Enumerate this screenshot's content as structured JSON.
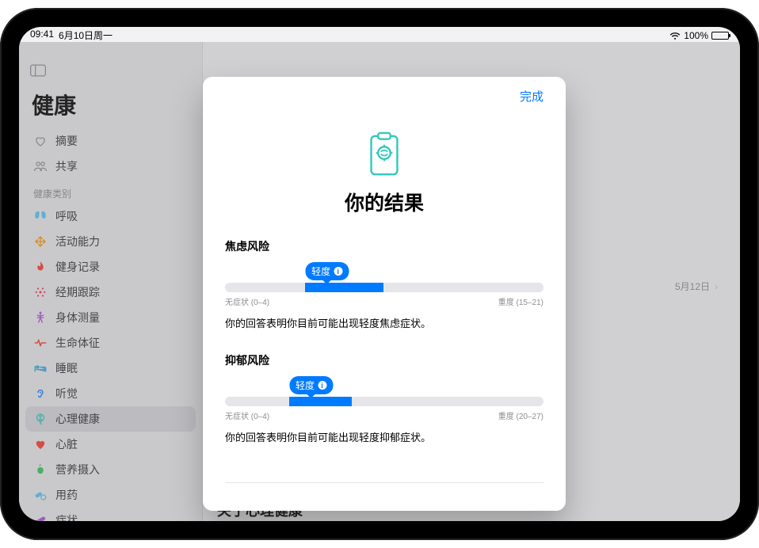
{
  "status": {
    "time": "09:41",
    "date": "6月10日周一",
    "battery_pct": "100%"
  },
  "sidebar": {
    "title": "健康",
    "summary_label": "摘要",
    "share_label": "共享",
    "category_heading": "健康类别",
    "items": [
      {
        "label": "呼吸",
        "icon": "lungs",
        "color": "#5ac8fa"
      },
      {
        "label": "活动能力",
        "icon": "arrows",
        "color": "#ff9500"
      },
      {
        "label": "健身记录",
        "icon": "flame",
        "color": "#ff3b30"
      },
      {
        "label": "经期跟踪",
        "icon": "dots-circle",
        "color": "#ff2d55"
      },
      {
        "label": "身体测量",
        "icon": "figure",
        "color": "#af52de"
      },
      {
        "label": "生命体征",
        "icon": "heartbeat",
        "color": "#ff3b30"
      },
      {
        "label": "睡眠",
        "icon": "bed",
        "color": "#32ade6"
      },
      {
        "label": "听觉",
        "icon": "ear",
        "color": "#007aff"
      },
      {
        "label": "心理健康",
        "icon": "brain",
        "color": "#34c8bd",
        "selected": true
      },
      {
        "label": "心脏",
        "icon": "heart",
        "color": "#ff3b30"
      },
      {
        "label": "营养摄入",
        "icon": "apple",
        "color": "#34c759"
      },
      {
        "label": "用药",
        "icon": "pills",
        "color": "#5ac8fa"
      },
      {
        "label": "症状",
        "icon": "bandage",
        "color": "#af52de"
      }
    ]
  },
  "main": {
    "history_date": "5月12日",
    "about_heading": "关于心理健康"
  },
  "modal": {
    "done_label": "完成",
    "title": "你的结果",
    "anxiety": {
      "heading": "焦虑风险",
      "bubble_label": "轻度",
      "bubble_offset_pct": 32,
      "segments": 4,
      "fill_index": 1,
      "scale_min_label": "无症状 (0–4)",
      "scale_max_label": "重度 (15–21)",
      "description": "你的回答表明你目前可能出现轻度焦虑症状。"
    },
    "depression": {
      "heading": "抑郁风险",
      "bubble_label": "轻度",
      "bubble_offset_pct": 27,
      "segments": 5,
      "fill_index": 1,
      "scale_min_label": "无症状 (0–4)",
      "scale_max_label": "重度 (20–27)",
      "description": "你的回答表明你目前可能出现轻度抑郁症状。"
    }
  }
}
